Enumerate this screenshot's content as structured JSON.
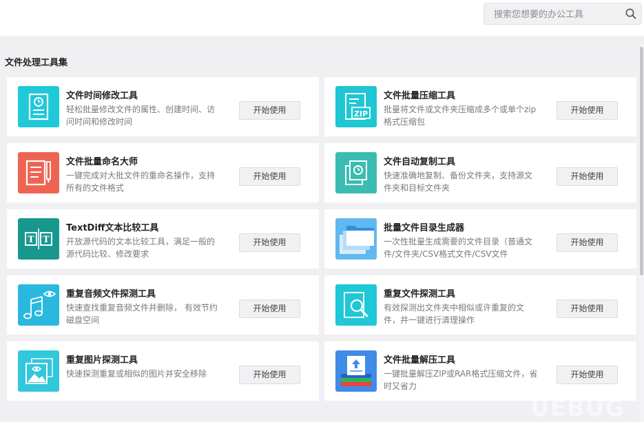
{
  "search": {
    "placeholder": "搜索您想要的办公工具"
  },
  "section": {
    "title": "文件处理工具集"
  },
  "tools": [
    {
      "title": "文件时间修改工具",
      "desc": "轻松批量修改文件的属性、创建时间、访问时间和修改时间",
      "button": "开始使用",
      "icon": "document-clock-icon",
      "color": "#19c4d4"
    },
    {
      "title": "文件批量压缩工具",
      "desc": "批量将文件或文件夹压缩成多个或单个zip格式压缩包",
      "button": "开始使用",
      "icon": "zip-archive-icon",
      "color": "#1fc6d3"
    },
    {
      "title": "文件批量命名大师",
      "desc": "一键完成对大批文件的重命名操作，支持所有的文件格式",
      "button": "开始使用",
      "icon": "document-pencil-icon",
      "color": "#ee6453"
    },
    {
      "title": "文件自动复制工具",
      "desc": "快速准确地复制、备份文件夹，支持源文件夹和目标文件夹",
      "button": "开始使用",
      "icon": "copy-clock-icon",
      "color": "#3bbcb2"
    },
    {
      "title": "TextDiff文本比较工具",
      "desc": "开放源代码的文本比较工具，满足一般的源代码比较、修改要求",
      "button": "开始使用",
      "icon": "text-compare-icon",
      "color": "#17988f"
    },
    {
      "title": "批量文件目录生成器",
      "desc": "一次性批量生成需要的文件目录（普通文件/文件夹/CSV格式文件/CSV文件",
      "button": "开始使用",
      "icon": "folder-stack-icon",
      "color": "#3aa3e6"
    },
    {
      "title": "重复音频文件探测工具",
      "desc": "快速查找重复音频文件并删除， 有效节约磁盘空间",
      "button": "开始使用",
      "icon": "music-eye-icon",
      "color": "#2ab8de"
    },
    {
      "title": "重复文件探测工具",
      "desc": "有效探测出文件夹中相似或许重复的文件，并一键进行清理操作",
      "button": "开始使用",
      "icon": "file-search-icon",
      "color": "#1ec8d6"
    },
    {
      "title": "重复图片探测工具",
      "desc": "快速探测重复或相似的图片并安全移除",
      "button": "开始使用",
      "icon": "image-eye-icon",
      "color": "#32c7dc"
    },
    {
      "title": "文件批量解压工具",
      "desc": "一键批量解压ZIP或RAR格式压缩文件，省时又省力",
      "button": "开始使用",
      "icon": "unzip-stack-icon",
      "color": "#2a6fd8"
    }
  ],
  "watermark": "UEBUG"
}
